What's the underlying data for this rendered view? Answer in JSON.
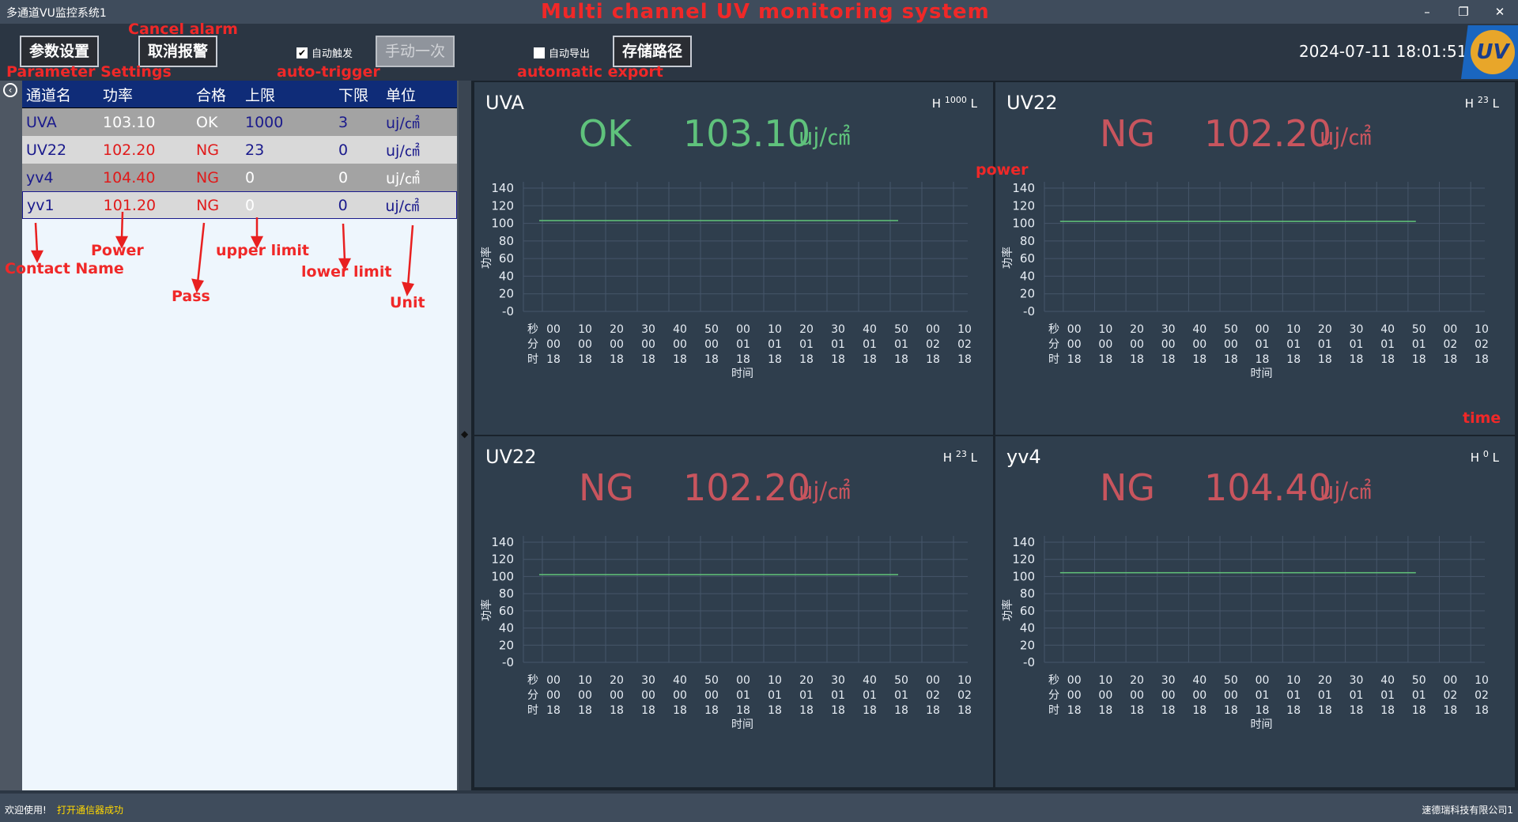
{
  "window": {
    "title": "多通道VU监控系统1",
    "annotation_title": "Multi channel UV monitoring system",
    "minimize": "–",
    "restore": "❐",
    "close": "✕"
  },
  "toolbar": {
    "param_label": "参数设置",
    "cancel_alarm_label": "取消报警",
    "auto_trigger_label": "自动触发",
    "auto_trigger_checked": true,
    "manual_once_label": "手动一次",
    "auto_export_label": "自动导出",
    "auto_export_checked": false,
    "storage_path_label": "存储路径",
    "datetime": "2024-07-11 18:01:51",
    "logo_text": "UV"
  },
  "annotations": {
    "parameter_settings": "Parameter Settings",
    "cancel_alarm": "Cancel alarm",
    "auto_trigger": "auto-trigger",
    "automatic_export": "automatic export",
    "contact_name": "Contact Name",
    "power": "Power",
    "pass": "Pass",
    "upper_limit": "upper limit",
    "lower_limit": "lower limit",
    "unit": "Unit",
    "power_chart": "power",
    "time_chart": "time"
  },
  "table": {
    "headers": [
      "通道名",
      "功率",
      "合格",
      "上限",
      "下限",
      "单位"
    ],
    "rows": [
      {
        "name": "UVA",
        "power": "103.10",
        "pass": "OK",
        "upper": "1000",
        "lower": "3",
        "unit": "uj/㎠"
      },
      {
        "name": "UV22",
        "power": "102.20",
        "pass": "NG",
        "upper": "23",
        "lower": "0",
        "unit": "uj/㎠"
      },
      {
        "name": "yv4",
        "power": "104.40",
        "pass": "NG",
        "upper": "0",
        "lower": "0",
        "unit": "uj/㎠"
      },
      {
        "name": "yv1",
        "power": "101.20",
        "pass": "NG",
        "upper": "0",
        "lower": "0",
        "unit": "uj/㎠"
      }
    ]
  },
  "colors": {
    "ok": "#5fc27c",
    "ng": "#c8555e",
    "chart_line": "#62c47a",
    "grid": "#46566a",
    "axis_text": "#e8eef5",
    "row_dark": "#a3a3a3",
    "row_light": "#d9d9d9",
    "row_sel": "#eef6fd",
    "header": "#0f2c78"
  },
  "cards": [
    {
      "title": "UVA",
      "h_label": "H",
      "h_value": "1000",
      "l_label": "L",
      "status": "OK",
      "value": "103.10",
      "unit": "uj/㎠"
    },
    {
      "title": "UV22",
      "h_label": "H",
      "h_value": "23",
      "l_label": "L",
      "status": "NG",
      "value": "102.20",
      "unit": "uj/㎠"
    },
    {
      "title": "UV22",
      "h_label": "H",
      "h_value": "23",
      "l_label": "L",
      "status": "NG",
      "value": "102.20",
      "unit": "uj/㎠"
    },
    {
      "title": "yv4",
      "h_label": "H",
      "h_value": "0",
      "l_label": "L",
      "status": "NG",
      "value": "104.40",
      "unit": "uj/㎠"
    }
  ],
  "chart_data": [
    {
      "type": "line",
      "title": "UVA",
      "ylabel": "功率",
      "xlabel": "时间",
      "ylim": [
        0,
        140
      ],
      "yticks": [
        "140",
        "120",
        "100",
        "80",
        "60",
        "40",
        "20",
        "-0"
      ],
      "xrow_labels": [
        "秒",
        "分",
        "时"
      ],
      "x_seconds": [
        "00",
        "10",
        "20",
        "30",
        "40",
        "50",
        "00",
        "10",
        "20",
        "30",
        "40",
        "50",
        "00",
        "10"
      ],
      "x_minutes": [
        "00",
        "00",
        "00",
        "00",
        "00",
        "00",
        "01",
        "01",
        "01",
        "01",
        "01",
        "01",
        "02",
        "02"
      ],
      "x_hours": [
        "18",
        "18",
        "18",
        "18",
        "18",
        "18",
        "18",
        "18",
        "18",
        "18",
        "18",
        "18",
        "18",
        "18"
      ],
      "series": [
        {
          "x_start": "18:00:00",
          "x_end": "18:01:50",
          "values": [
            103.1,
            103.1
          ]
        }
      ],
      "grid": true
    },
    {
      "type": "line",
      "title": "UV22",
      "ylabel": "功率",
      "xlabel": "时间",
      "ylim": [
        0,
        140
      ],
      "yticks": [
        "140",
        "120",
        "100",
        "80",
        "60",
        "40",
        "20",
        "-0"
      ],
      "xrow_labels": [
        "秒",
        "分",
        "时"
      ],
      "x_seconds": [
        "00",
        "10",
        "20",
        "30",
        "40",
        "50",
        "00",
        "10",
        "20",
        "30",
        "40",
        "50",
        "00",
        "10"
      ],
      "x_minutes": [
        "00",
        "00",
        "00",
        "00",
        "00",
        "00",
        "01",
        "01",
        "01",
        "01",
        "01",
        "01",
        "02",
        "02"
      ],
      "x_hours": [
        "18",
        "18",
        "18",
        "18",
        "18",
        "18",
        "18",
        "18",
        "18",
        "18",
        "18",
        "18",
        "18",
        "18"
      ],
      "series": [
        {
          "x_start": "18:00:00",
          "x_end": "18:01:50",
          "values": [
            102.2,
            102.2
          ]
        }
      ],
      "grid": true
    },
    {
      "type": "line",
      "title": "UV22",
      "ylabel": "功率",
      "xlabel": "时间",
      "ylim": [
        0,
        140
      ],
      "yticks": [
        "140",
        "120",
        "100",
        "80",
        "60",
        "40",
        "20",
        "-0"
      ],
      "xrow_labels": [
        "秒",
        "分",
        "时"
      ],
      "x_seconds": [
        "00",
        "10",
        "20",
        "30",
        "40",
        "50",
        "00",
        "10",
        "20",
        "30",
        "40",
        "50",
        "00",
        "10"
      ],
      "x_minutes": [
        "00",
        "00",
        "00",
        "00",
        "00",
        "00",
        "01",
        "01",
        "01",
        "01",
        "01",
        "01",
        "02",
        "02"
      ],
      "x_hours": [
        "18",
        "18",
        "18",
        "18",
        "18",
        "18",
        "18",
        "18",
        "18",
        "18",
        "18",
        "18",
        "18",
        "18"
      ],
      "series": [
        {
          "x_start": "18:00:00",
          "x_end": "18:01:50",
          "values": [
            102.2,
            102.2
          ]
        }
      ],
      "grid": true
    },
    {
      "type": "line",
      "title": "yv4",
      "ylabel": "功率",
      "xlabel": "时间",
      "ylim": [
        0,
        140
      ],
      "yticks": [
        "140",
        "120",
        "100",
        "80",
        "60",
        "40",
        "20",
        "-0"
      ],
      "xrow_labels": [
        "秒",
        "分",
        "时"
      ],
      "x_seconds": [
        "00",
        "10",
        "20",
        "30",
        "40",
        "50",
        "00",
        "10",
        "20",
        "30",
        "40",
        "50",
        "00",
        "10"
      ],
      "x_minutes": [
        "00",
        "00",
        "00",
        "00",
        "00",
        "00",
        "01",
        "01",
        "01",
        "01",
        "01",
        "01",
        "02",
        "02"
      ],
      "x_hours": [
        "18",
        "18",
        "18",
        "18",
        "18",
        "18",
        "18",
        "18",
        "18",
        "18",
        "18",
        "18",
        "18",
        "18"
      ],
      "series": [
        {
          "x_start": "18:00:00",
          "x_end": "18:01:50",
          "values": [
            104.4,
            104.4
          ]
        }
      ],
      "grid": true
    }
  ],
  "statusbar": {
    "welcome": "欢迎使用!",
    "message": "打开通信器成功",
    "company": "速德瑞科技有限公司1"
  }
}
